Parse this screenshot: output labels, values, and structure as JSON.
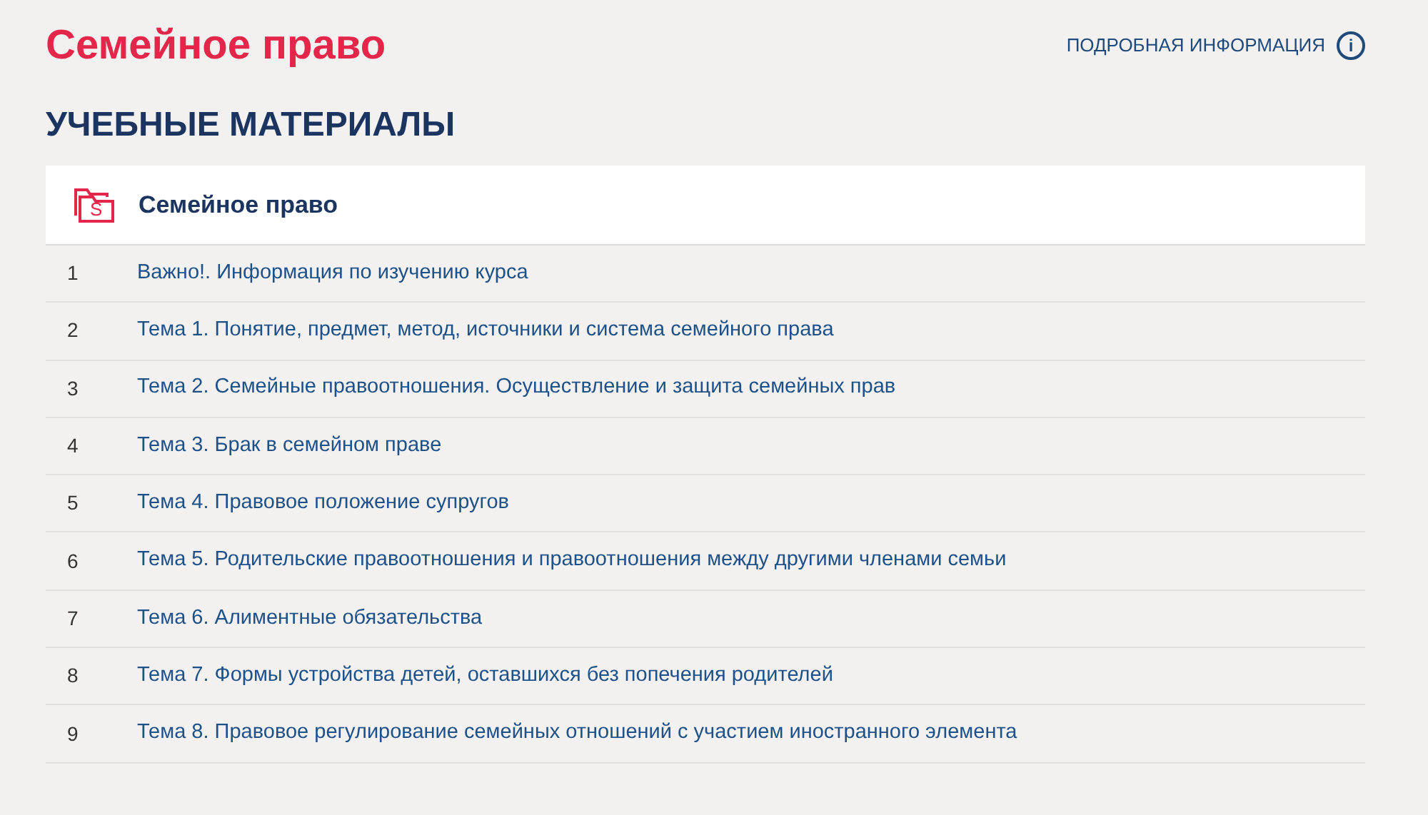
{
  "page_title": "Семейное право",
  "info_link": {
    "label": "ПОДРОБНАЯ ИНФОРМАЦИЯ",
    "icon": "i"
  },
  "section_heading": "УЧЕБНЫЕ МАТЕРИАЛЫ",
  "course": {
    "title": "Семейное право",
    "icon_letter": "S"
  },
  "materials": [
    {
      "number": "1",
      "title": "Важно!. Информация по изучению курса"
    },
    {
      "number": "2",
      "title": "Тема 1. Понятие, предмет, метод, источники и система семейного права"
    },
    {
      "number": "3",
      "title": "Тема 2. Семейные правоотношения. Осуществление и защита семейных прав"
    },
    {
      "number": "4",
      "title": "Тема 3. Брак в семейном праве"
    },
    {
      "number": "5",
      "title": "Тема 4. Правовое положение супругов"
    },
    {
      "number": "6",
      "title": "Тема 5. Родительские правоотношения и правоотношения между другими членами семьи"
    },
    {
      "number": "7",
      "title": "Тема 6. Алиментные обязательства"
    },
    {
      "number": "8",
      "title": "Тема 7. Формы устройства детей, оставшихся без попечения родителей"
    },
    {
      "number": "9",
      "title": "Тема 8. Правовое регулирование семейных отношений с участием иностранного элемента"
    }
  ]
}
